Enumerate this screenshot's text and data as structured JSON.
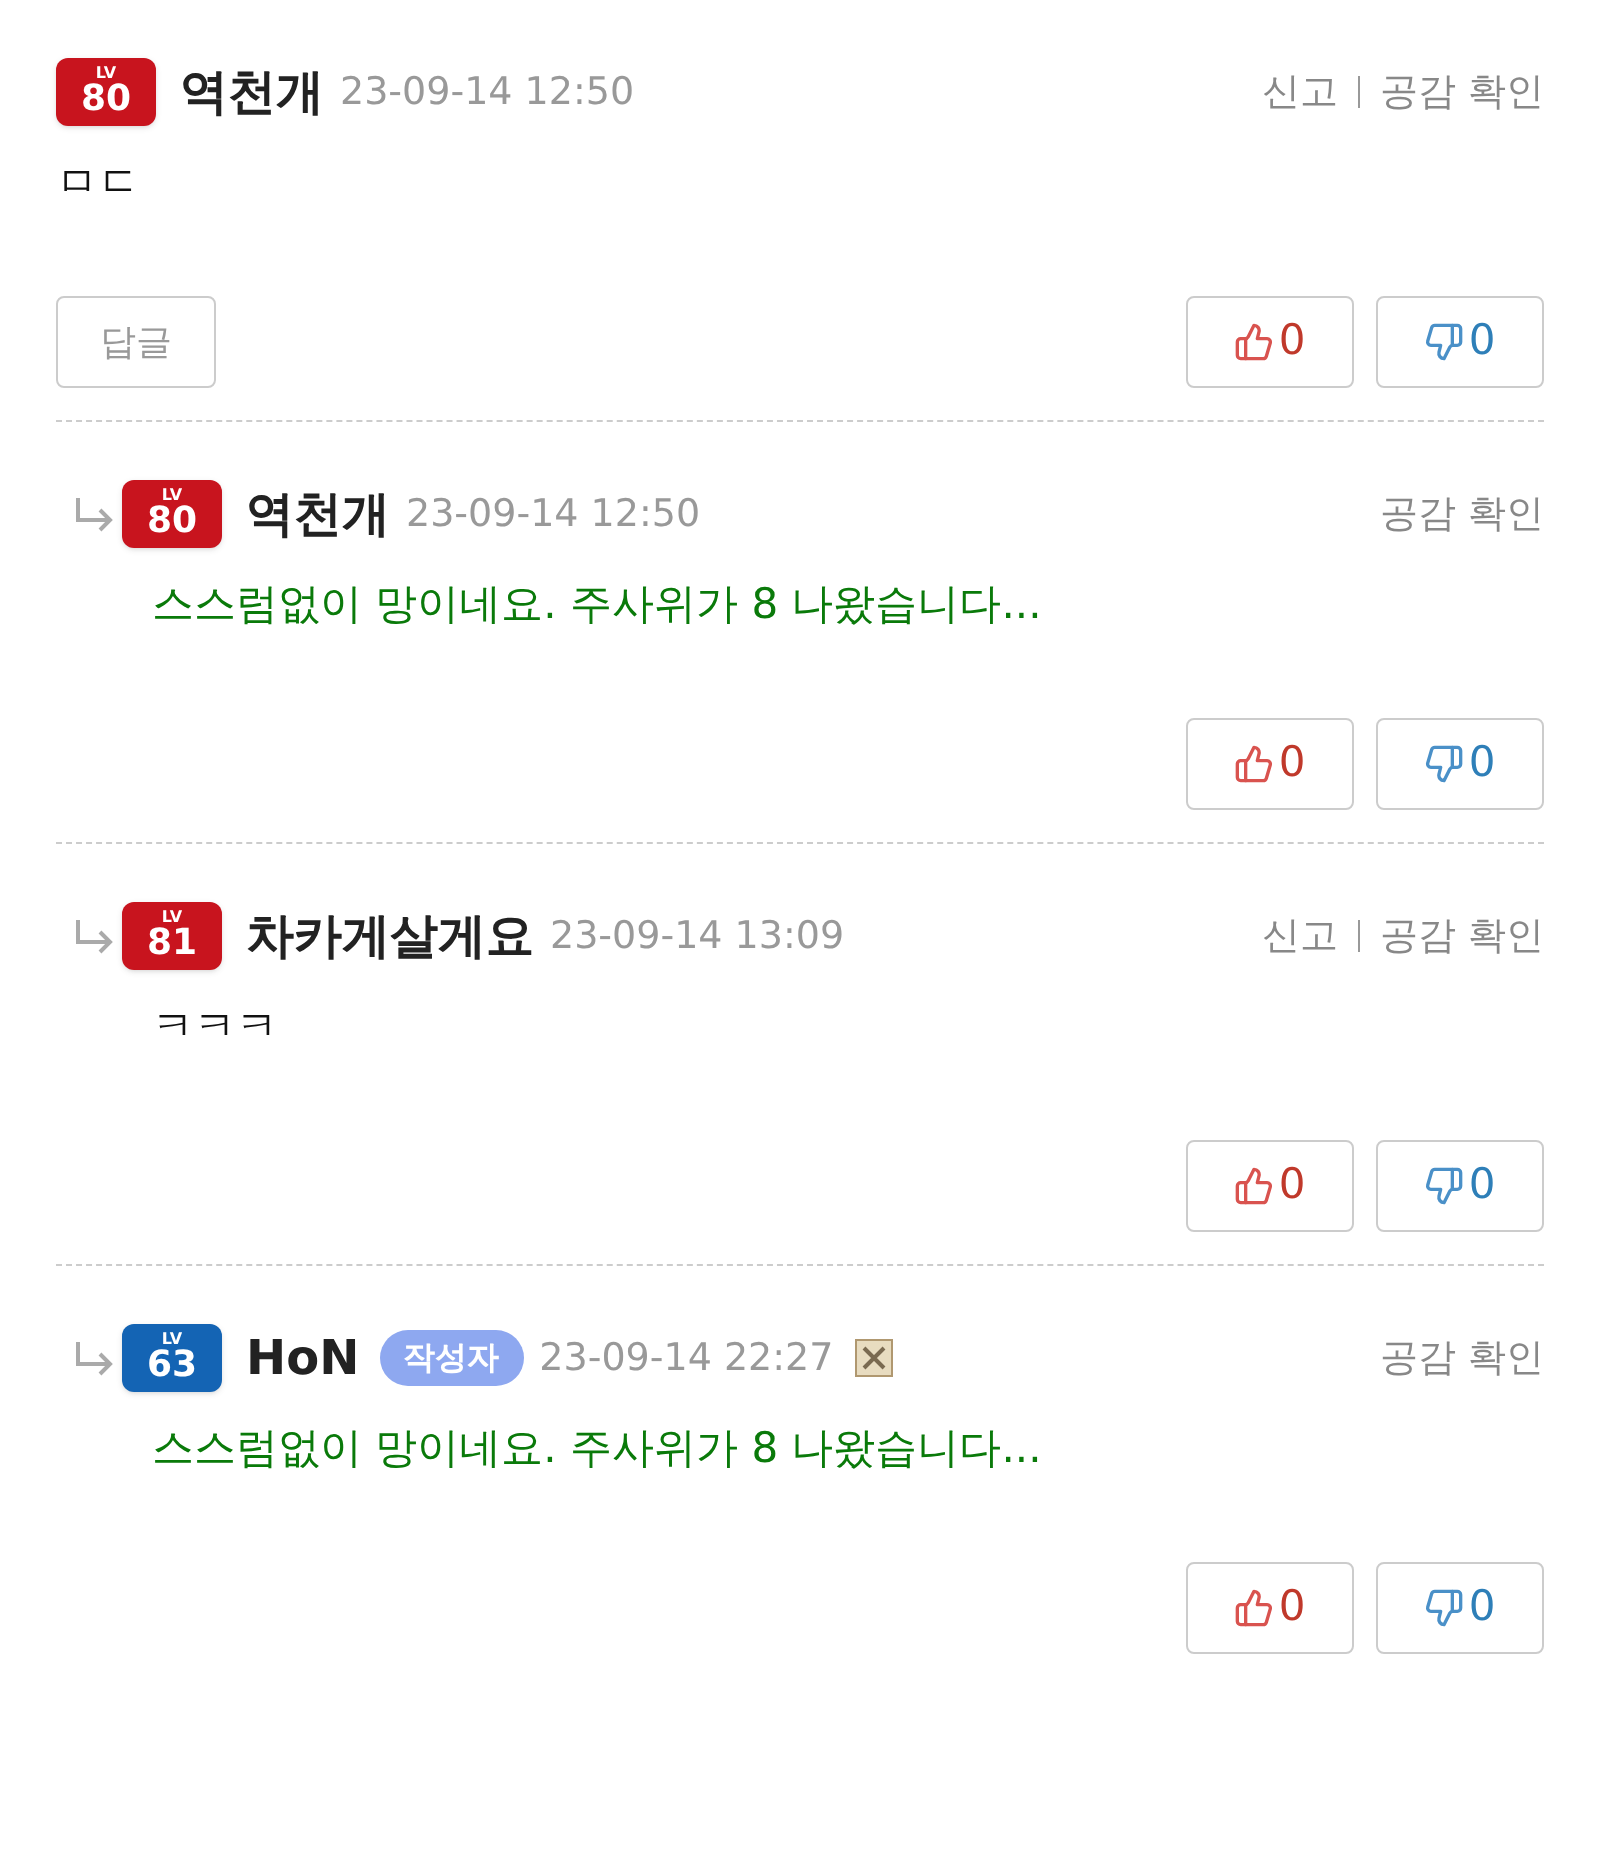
{
  "comments": [
    {
      "kind": "comment",
      "badge": {
        "label": "LV",
        "number": "80",
        "color": "#c8141e"
      },
      "name": "역천개",
      "date": "23-09-14 12:50",
      "report": "신고",
      "empathy": "공감 확인",
      "content": "ㅁㄷ",
      "color": "#111111",
      "reply_button": "답글",
      "likes": "0",
      "dislikes": "0",
      "has_delete_icon": false
    },
    {
      "kind": "reply",
      "badge": {
        "label": "LV",
        "number": "80",
        "color": "#c8141e"
      },
      "name": "역천개",
      "date": "23-09-14 12:50",
      "empathy": "공감 확인",
      "content": "스스럼없이 망이네요. 주사위가 8 나왔습니다...",
      "color": "#0a7a0a",
      "likes": "0",
      "dislikes": "0",
      "has_delete_icon": false
    },
    {
      "kind": "reply",
      "badge": {
        "label": "LV",
        "number": "81",
        "color": "#c8141e"
      },
      "name": "차카게살게요",
      "date": "23-09-14 13:09",
      "report": "신고",
      "empathy": "공감 확인",
      "content": "ㅋㅋㅋ",
      "color": "#111111",
      "likes": "0",
      "dislikes": "0",
      "has_delete_icon": false
    },
    {
      "kind": "reply",
      "badge": {
        "label": "LV",
        "number": "63",
        "color": "#1464b4"
      },
      "name": "HoN",
      "author_tag": "작성자",
      "date": "23-09-14 22:27",
      "empathy": "공감 확인",
      "content": "스스럼없이 망이네요. 주사위가 8 나왔습니다...",
      "color": "#0a7a0a",
      "likes": "0",
      "dislikes": "0",
      "has_delete_icon": true
    }
  ]
}
